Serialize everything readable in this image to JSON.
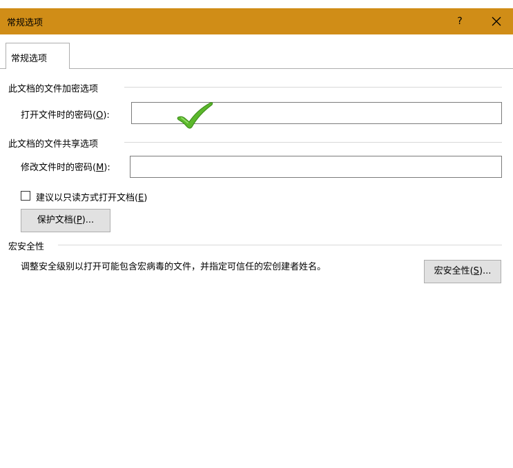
{
  "window": {
    "title": "常规选项",
    "help_label": "?"
  },
  "tabs": [
    {
      "label": "常规选项",
      "selected": true
    }
  ],
  "encryption": {
    "section_title": "此文档的文件加密选项",
    "open_password_label": "打开文件时的密码(",
    "open_password_key": "O",
    "open_password_label_tail": "):",
    "open_password_value": ""
  },
  "sharing": {
    "section_title": "此文档的文件共享选项",
    "modify_password_label": "修改文件时的密码(",
    "modify_password_key": "M",
    "modify_password_label_tail": "):",
    "modify_password_value": "",
    "readonly_label": "建议以只读方式打开文档(",
    "readonly_key": "E",
    "readonly_label_tail": ")",
    "readonly_checked": false,
    "protect_button_label": "保护文档(",
    "protect_button_key": "P",
    "protect_button_tail": ")..."
  },
  "macro": {
    "section_title": "宏安全性",
    "description": "调整安全级别以打开可能包含宏病毒的文件，并指定可信任的宏创建者姓名。",
    "button_label": "宏安全性(",
    "button_key": "S",
    "button_tail": ")..."
  },
  "annotation": {
    "icon": "check-mark-icon",
    "color": "#5cb82c"
  },
  "colors": {
    "titlebar": "#d08d17",
    "button_face": "#e1e1e1"
  }
}
